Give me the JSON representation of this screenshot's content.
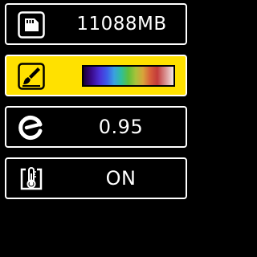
{
  "rows": [
    {
      "name": "storage",
      "icon": "sd-card-icon",
      "value": "11088MB",
      "selected": false
    },
    {
      "name": "palette",
      "icon": "paint-brush-icon",
      "value": "",
      "selected": true
    },
    {
      "name": "emissivity",
      "icon": "emissivity-icon",
      "value": "0.95",
      "selected": false
    },
    {
      "name": "temperature",
      "icon": "thermometer-icon",
      "value": "ON",
      "selected": false
    }
  ],
  "colors": {
    "background": "#000000",
    "border": "#ffffff",
    "selected_background": "#ffe100",
    "text": "#ffffff"
  }
}
